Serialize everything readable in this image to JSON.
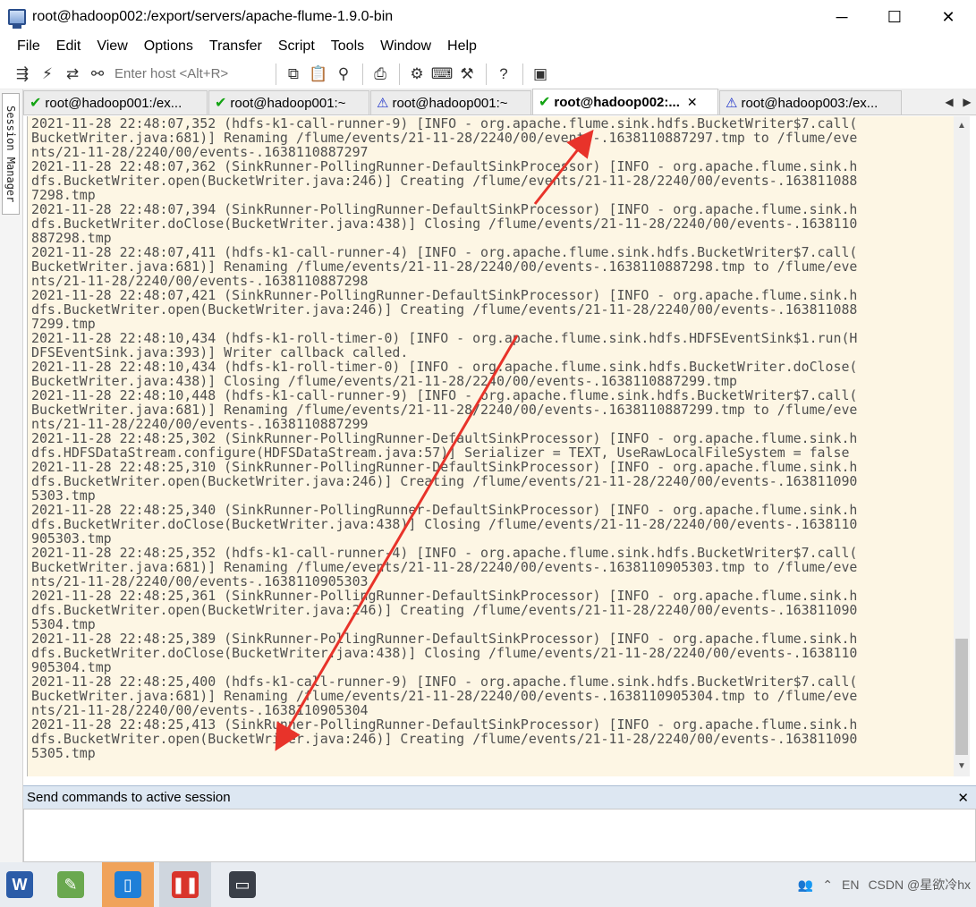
{
  "window": {
    "title": "root@hadoop002:/export/servers/apache-flume-1.9.0-bin",
    "minimize": "─",
    "maximize": "☐",
    "close": "✕"
  },
  "menu": [
    "File",
    "Edit",
    "View",
    "Options",
    "Transfer",
    "Script",
    "Tools",
    "Window",
    "Help"
  ],
  "toolbar": {
    "host_placeholder": "Enter host <Alt+R>",
    "icons": [
      "connect-icon",
      "quick-connect-icon",
      "reconnect-icon",
      "disconnect-icon",
      "copy-icon",
      "paste-icon",
      "find-icon",
      "print-icon",
      "settings-icon",
      "keymap-icon",
      "sftp-icon",
      "help-icon",
      "screenshot-icon"
    ]
  },
  "session_manager": {
    "label": "Session Manager"
  },
  "tabs": [
    {
      "label": "root@hadoop001:/ex...",
      "status": "ok",
      "active": false
    },
    {
      "label": "root@hadoop001:~",
      "status": "ok",
      "active": false
    },
    {
      "label": "root@hadoop001:~",
      "status": "warn",
      "active": false
    },
    {
      "label": "root@hadoop002:...",
      "status": "ok",
      "active": true
    },
    {
      "label": "root@hadoop003:/ex...",
      "status": "warn",
      "active": false
    }
  ],
  "terminal": {
    "lines": [
      "2021-11-28 22:48:07,352 (hdfs-k1-call-runner-9) [INFO - org.apache.flume.sink.hdfs.BucketWriter$7.call(",
      "BucketWriter.java:681)] Renaming /flume/events/21-11-28/2240/00/events-.1638110887297.tmp to /flume/eve",
      "nts/21-11-28/2240/00/events-.1638110887297",
      "2021-11-28 22:48:07,362 (SinkRunner-PollingRunner-DefaultSinkProcessor) [INFO - org.apache.flume.sink.h",
      "dfs.BucketWriter.open(BucketWriter.java:246)] Creating /flume/events/21-11-28/2240/00/events-.163811088",
      "7298.tmp",
      "2021-11-28 22:48:07,394 (SinkRunner-PollingRunner-DefaultSinkProcessor) [INFO - org.apache.flume.sink.h",
      "dfs.BucketWriter.doClose(BucketWriter.java:438)] Closing /flume/events/21-11-28/2240/00/events-.1638110",
      "887298.tmp",
      "2021-11-28 22:48:07,411 (hdfs-k1-call-runner-4) [INFO - org.apache.flume.sink.hdfs.BucketWriter$7.call(",
      "BucketWriter.java:681)] Renaming /flume/events/21-11-28/2240/00/events-.1638110887298.tmp to /flume/eve",
      "nts/21-11-28/2240/00/events-.1638110887298",
      "2021-11-28 22:48:07,421 (SinkRunner-PollingRunner-DefaultSinkProcessor) [INFO - org.apache.flume.sink.h",
      "dfs.BucketWriter.open(BucketWriter.java:246)] Creating /flume/events/21-11-28/2240/00/events-.163811088",
      "7299.tmp",
      "2021-11-28 22:48:10,434 (hdfs-k1-roll-timer-0) [INFO - org.apache.flume.sink.hdfs.HDFSEventSink$1.run(H",
      "DFSEventSink.java:393)] Writer callback called.",
      "2021-11-28 22:48:10,434 (hdfs-k1-roll-timer-0) [INFO - org.apache.flume.sink.hdfs.BucketWriter.doClose(",
      "BucketWriter.java:438)] Closing /flume/events/21-11-28/2240/00/events-.1638110887299.tmp",
      "2021-11-28 22:48:10,448 (hdfs-k1-call-runner-9) [INFO - org.apache.flume.sink.hdfs.BucketWriter$7.call(",
      "BucketWriter.java:681)] Renaming /flume/events/21-11-28/2240/00/events-.1638110887299.tmp to /flume/eve",
      "nts/21-11-28/2240/00/events-.1638110887299",
      "2021-11-28 22:48:25,302 (SinkRunner-PollingRunner-DefaultSinkProcessor) [INFO - org.apache.flume.sink.h",
      "dfs.HDFSDataStream.configure(HDFSDataStream.java:57)] Serializer = TEXT, UseRawLocalFileSystem = false",
      "2021-11-28 22:48:25,310 (SinkRunner-PollingRunner-DefaultSinkProcessor) [INFO - org.apache.flume.sink.h",
      "dfs.BucketWriter.open(BucketWriter.java:246)] Creating /flume/events/21-11-28/2240/00/events-.163811090",
      "5303.tmp",
      "2021-11-28 22:48:25,340 (SinkRunner-PollingRunner-DefaultSinkProcessor) [INFO - org.apache.flume.sink.h",
      "dfs.BucketWriter.doClose(BucketWriter.java:438)] Closing /flume/events/21-11-28/2240/00/events-.1638110",
      "905303.tmp",
      "2021-11-28 22:48:25,352 (hdfs-k1-call-runner-4) [INFO - org.apache.flume.sink.hdfs.BucketWriter$7.call(",
      "BucketWriter.java:681)] Renaming /flume/events/21-11-28/2240/00/events-.1638110905303.tmp to /flume/eve",
      "nts/21-11-28/2240/00/events-.1638110905303",
      "2021-11-28 22:48:25,361 (SinkRunner-PollingRunner-DefaultSinkProcessor) [INFO - org.apache.flume.sink.h",
      "dfs.BucketWriter.open(BucketWriter.java:246)] Creating /flume/events/21-11-28/2240/00/events-.163811090",
      "5304.tmp",
      "2021-11-28 22:48:25,389 (SinkRunner-PollingRunner-DefaultSinkProcessor) [INFO - org.apache.flume.sink.h",
      "dfs.BucketWriter.doClose(BucketWriter.java:438)] Closing /flume/events/21-11-28/2240/00/events-.1638110",
      "905304.tmp",
      "2021-11-28 22:48:25,400 (hdfs-k1-call-runner-9) [INFO - org.apache.flume.sink.hdfs.BucketWriter$7.call(",
      "BucketWriter.java:681)] Renaming /flume/events/21-11-28/2240/00/events-.1638110905304.tmp to /flume/eve",
      "nts/21-11-28/2240/00/events-.1638110905304",
      "2021-11-28 22:48:25,413 (SinkRunner-PollingRunner-DefaultSinkProcessor) [INFO - org.apache.flume.sink.h",
      "dfs.BucketWriter.open(BucketWriter.java:246)] Creating /flume/events/21-11-28/2240/00/events-.163811090",
      "5305.tmp"
    ]
  },
  "command_panel": {
    "title": "Send commands to active session",
    "close": "✕"
  },
  "taskbar": {
    "apps": [
      "word-icon",
      "notepad-icon",
      "phone-icon",
      "recorder-icon",
      "securecrt-icon"
    ],
    "tray": {
      "lang": "EN",
      "watermark": "CSDN @星欲冷hx"
    }
  },
  "colors": {
    "terminal_bg": "#fdf6e4",
    "terminal_fg": "#4f4f4f",
    "arrow": "#e8332a"
  }
}
